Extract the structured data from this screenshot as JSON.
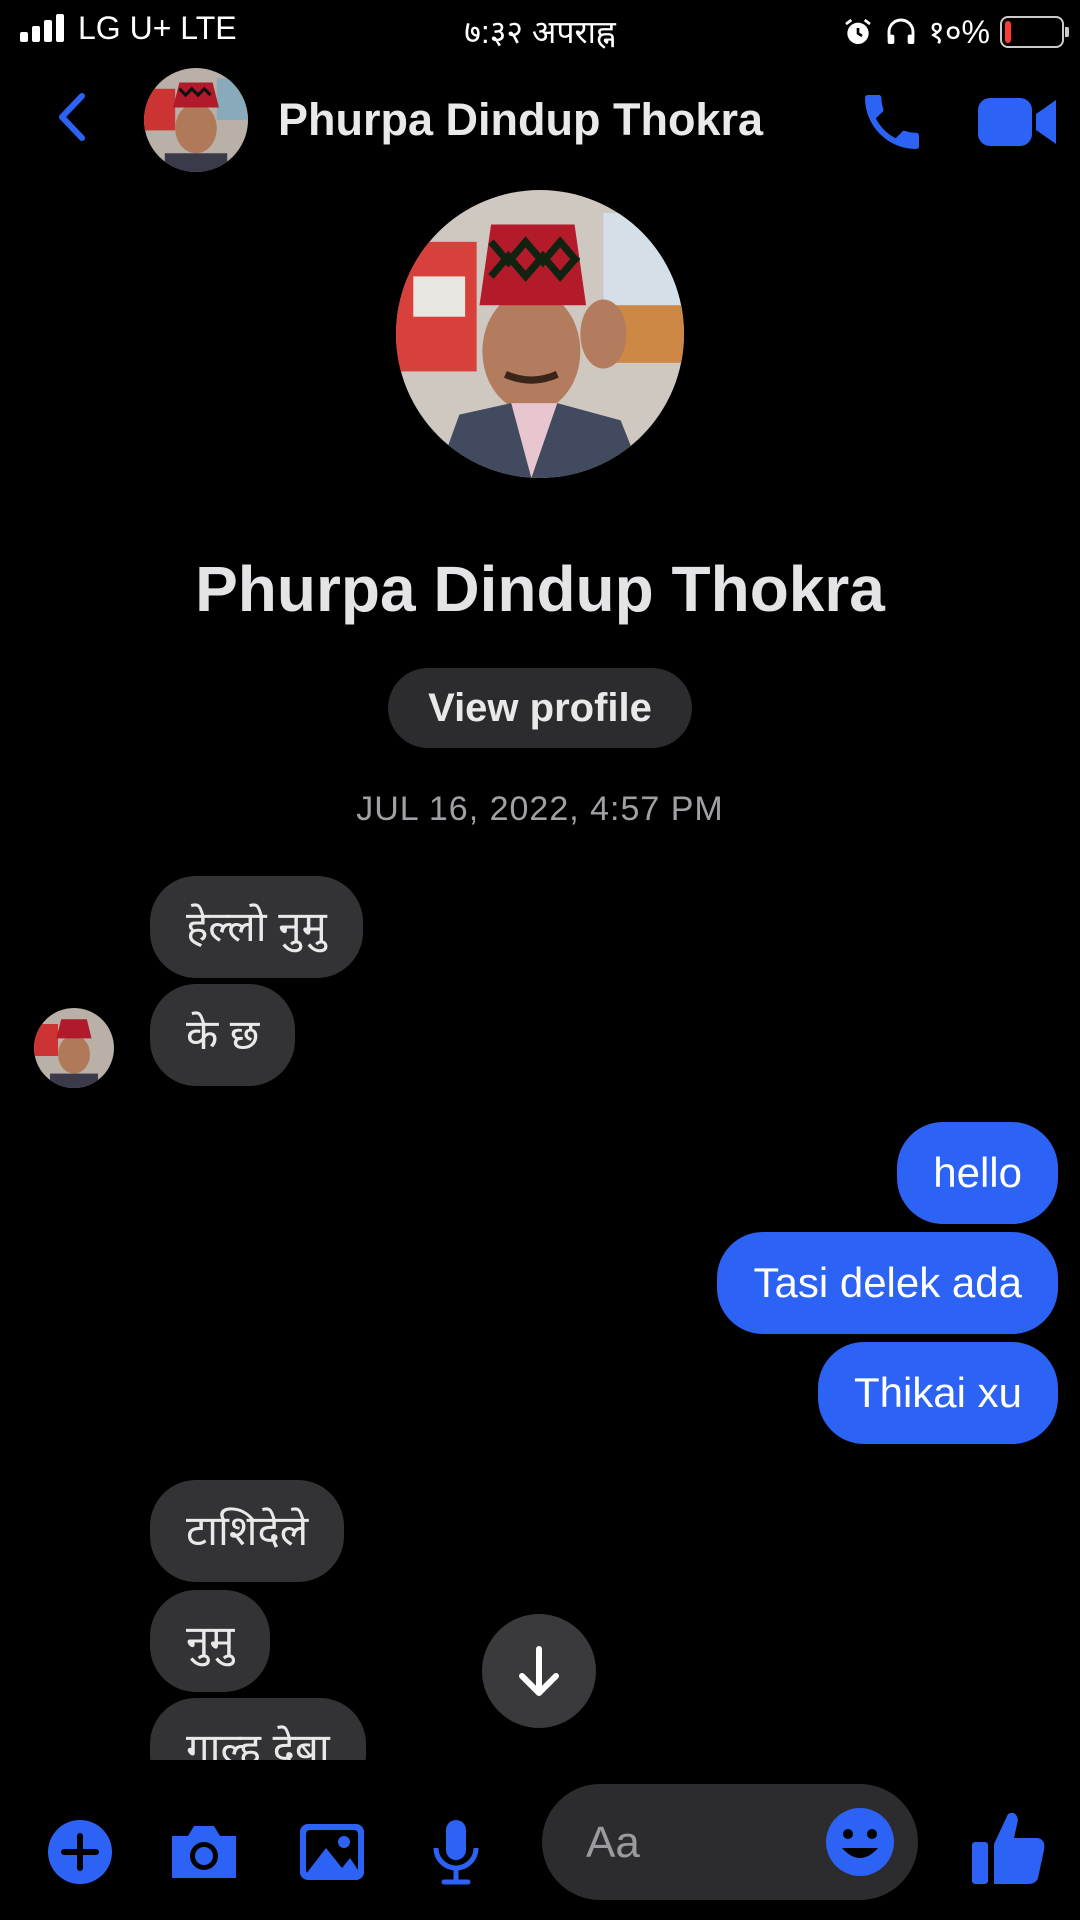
{
  "status_bar": {
    "carrier": "LG U+  LTE",
    "time": "७:३२ अपराह्न",
    "battery": "१०%",
    "battery_level": 0.1
  },
  "header": {
    "contact_name": "Phurpa Dindup Thokra"
  },
  "profile": {
    "name": "Phurpa Dindup Thokra",
    "view_profile_label": "View profile"
  },
  "conversation": {
    "timestamp": "JUL 16, 2022, 4:57 PM",
    "incoming_1": [
      "हेल्लो नुमु",
      "के छ"
    ],
    "outgoing_1": [
      "hello",
      "Tasi delek ada",
      "Thikai xu"
    ],
    "incoming_2": [
      "टाशिदेले",
      "नुमु",
      "गाल्ह देबा"
    ]
  },
  "composer": {
    "placeholder": "Aa"
  },
  "colors": {
    "accent": "#2d63f4",
    "incoming_bubble": "#333335",
    "background": "#000000"
  },
  "icons": [
    "back-icon",
    "phone-icon",
    "video-camera-icon",
    "plus-icon",
    "camera-icon",
    "photo-icon",
    "microphone-icon",
    "emoji-icon",
    "thumbs-up-icon",
    "arrow-down-icon"
  ]
}
